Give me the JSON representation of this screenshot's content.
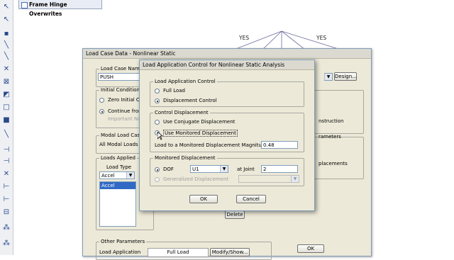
{
  "app": {
    "tab_title": "Frame Hinge Overwrites"
  },
  "canvas": {
    "yes_labels": [
      "YES",
      "YES"
    ]
  },
  "load_case": {
    "title": "Load Case Data - Nonlinear Static",
    "name_group": "Load Case Name",
    "name_value": "PUSH",
    "design_button": "Design...",
    "initial_conditions": "Initial Conditions",
    "zero_initial": "Zero Initial Co",
    "continue_from": "Continue from",
    "important_note": "Important Note",
    "modal_group": "Modal Load Case",
    "modal_all": "All Modal Loads A",
    "loads_applied": "Loads Applied",
    "load_type_header": "Load Type",
    "load_type_value": "Accel",
    "list_items": [
      "Accel"
    ],
    "delete_button": "Delete",
    "right_construction": "nstruction",
    "right_parameters": "rameters",
    "right_placements": "placements",
    "other_params": "Other Parameters",
    "load_application_label": "Load Application",
    "load_application_value": "Full Load",
    "modify_show_button": "Modify/Show...",
    "ok_button": "OK"
  },
  "dialog": {
    "title": "Load Application Control for Nonlinear Static Analysis",
    "group_control": "Load Application Control",
    "full_load": "Full Load",
    "displacement_control": "Displacement Control",
    "group_control_disp": "Control Displacement",
    "use_conjugate": "Use Conjugate Displacement",
    "use_monitored": "Use Monitored Displacement",
    "load_to_monitored_label": "Load to a Monitored Displacement Magnitude of",
    "load_to_monitored_value": "0.48",
    "group_monitored": "Monitored Displacement",
    "dof_label": "DOF",
    "dof_value": "U1",
    "at_joint_label": "at Joint",
    "at_joint_value": "2",
    "generalized": "Generalized Displacement",
    "ok": "OK",
    "cancel": "Cancel"
  }
}
